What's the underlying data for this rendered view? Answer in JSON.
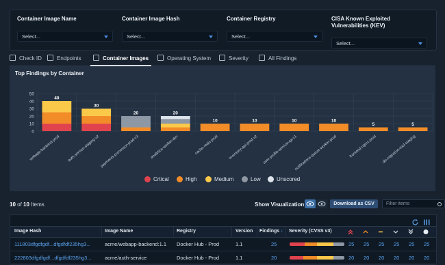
{
  "filters": [
    {
      "label": "Container Image Name",
      "value": "Select..."
    },
    {
      "label": "Container Image Hash",
      "value": "Select..."
    },
    {
      "label": "Container Registry",
      "value": "Select..."
    },
    {
      "label": "CISA Known Exploited Vulnerabilities (KEV)",
      "value": "Select..."
    }
  ],
  "tabs": [
    {
      "label": "Check ID",
      "icon": "cube-icon"
    },
    {
      "label": "Endpoints",
      "icon": "monitor-icon"
    },
    {
      "label": "Container Images",
      "icon": "layers-icon",
      "active": true
    },
    {
      "label": "Operating System",
      "icon": "layers-icon"
    },
    {
      "label": "Severity",
      "icon": "layers-icon"
    },
    {
      "label": "All Findings",
      "icon": "cube-icon"
    }
  ],
  "chart_title": "Top Findings by Container",
  "chart_data": {
    "type": "bar",
    "title": "Top Findings by Container",
    "ylim": [
      0,
      50
    ],
    "yticks": [
      0,
      10,
      20,
      30,
      40,
      50
    ],
    "grid": true,
    "stacked": true,
    "categories": [
      "webapp-backend-prod",
      "auth-service-staging-v2",
      "payments-processor-prod-v3",
      "analytics-worker-dev",
      "cache-redis-prod",
      "inventory-api-prod-v2",
      "user-profile-service-qa-v1",
      "notifications-queue-worker-prod",
      "frontend-nginx-prod",
      "db-migration-tool-staging"
    ],
    "totals": [
      40,
      30,
      20,
      20,
      10,
      10,
      10,
      10,
      5,
      5
    ],
    "series": [
      {
        "name": "Crtical",
        "color": "#e0434e",
        "values": [
          10,
          10,
          0,
          0,
          0,
          0,
          0,
          0,
          0,
          0
        ]
      },
      {
        "name": "High",
        "color": "#f28c28",
        "values": [
          15,
          10,
          5,
          5,
          10,
          10,
          10,
          10,
          5,
          5
        ]
      },
      {
        "name": "Medium",
        "color": "#fbc94a",
        "values": [
          15,
          10,
          0,
          5,
          0,
          0,
          0,
          0,
          0,
          0
        ]
      },
      {
        "name": "Low",
        "color": "#8e98a5",
        "values": [
          0,
          0,
          15,
          6,
          0,
          0,
          0,
          0,
          0,
          0
        ]
      },
      {
        "name": "Unscored",
        "color": "#dce3ea",
        "values": [
          0,
          0,
          0,
          4,
          0,
          0,
          0,
          0,
          0,
          0
        ]
      }
    ],
    "legend_position": "bottom"
  },
  "toolbar": {
    "count_shown": "10",
    "count_of": "of",
    "count_total": "10",
    "count_suffix": "Items",
    "viz_label": "Show Visualization:",
    "csv_label": "Download as CSV",
    "filter_placeholder": "Filter items"
  },
  "table": {
    "headers": [
      "Image Hash",
      "Image Name",
      "Registry",
      "Version",
      "Findings",
      "Severity (CVSS v3)"
    ],
    "sort_arrow": "↓",
    "rows": [
      {
        "hash": "111803dfgdfgdf...dfgdfdf235hg3...",
        "name": "acme/webapp-backend:1.1",
        "registry": "Docker Hub - Prod",
        "version": "1.1",
        "findings": "25",
        "sev": [
          28,
          22,
          30,
          20
        ],
        "counts": [
          "25",
          "25",
          "25",
          "25",
          "25",
          "25"
        ]
      },
      {
        "hash": "222803dfgdfgdf...dfgdfdf235hg3...",
        "name": "acme/auth-service",
        "registry": "Docker Hub - Prod",
        "version": "1.1",
        "findings": "20",
        "sev": [
          25,
          25,
          30,
          20
        ],
        "counts": [
          "20",
          "20",
          "20",
          "20",
          "20",
          "20"
        ]
      }
    ]
  }
}
